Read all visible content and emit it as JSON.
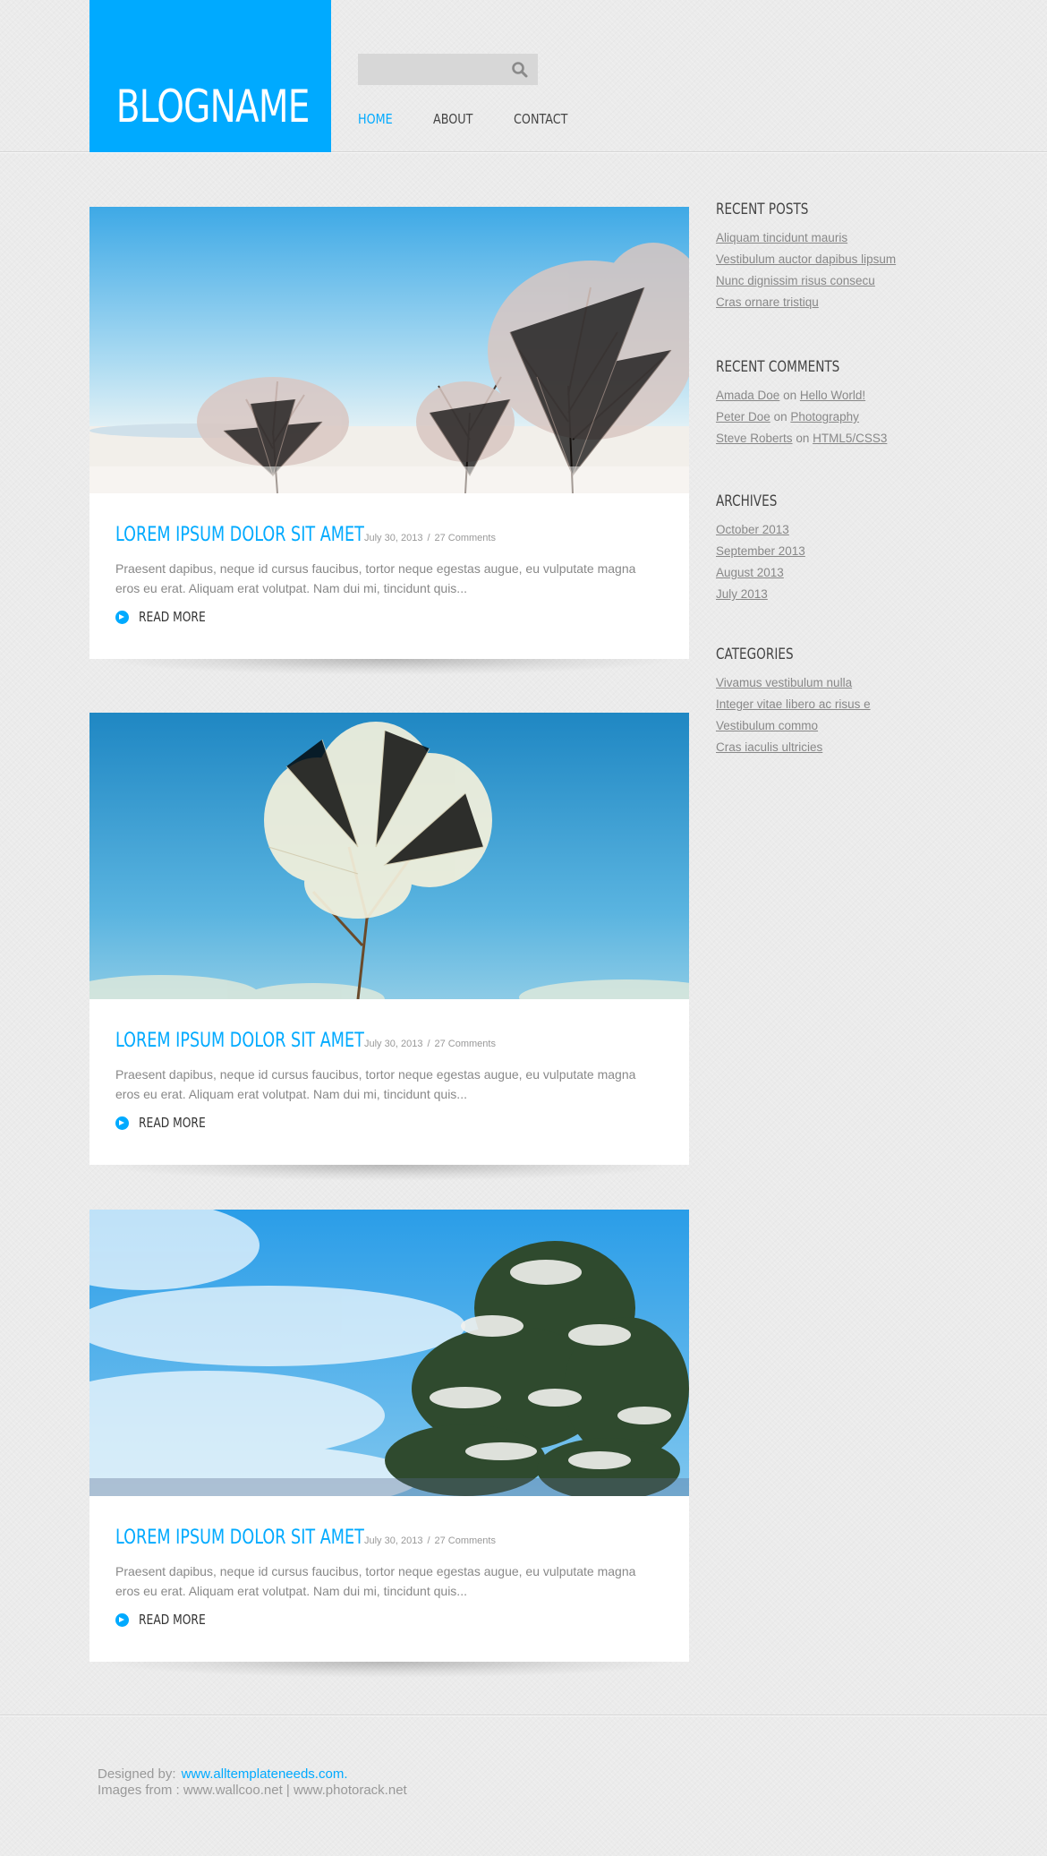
{
  "header": {
    "logo": "BLOGNAME",
    "search": {
      "placeholder": ""
    },
    "nav": [
      "HOME",
      "ABOUT",
      "CONTACT"
    ]
  },
  "posts": [
    {
      "title": "LOREM IPSUM DOLOR SIT AMET",
      "date": "July 30, 2013",
      "comments": "27 Comments",
      "excerpt": "Praesent dapibus, neque id cursus faucibus, tortor neque egestas augue, eu vulputate magna eros eu erat. Aliquam erat volutpat. Nam dui mi, tincidunt quis...",
      "read_more": "READ MORE"
    },
    {
      "title": "LOREM IPSUM DOLOR SIT AMET",
      "date": "July 30, 2013",
      "comments": "27 Comments",
      "excerpt": "Praesent dapibus, neque id cursus faucibus, tortor neque egestas augue, eu vulputate magna eros eu erat. Aliquam erat volutpat. Nam dui mi, tincidunt quis...",
      "read_more": "READ MORE"
    },
    {
      "title": "LOREM IPSUM DOLOR SIT AMET",
      "date": "July 30, 2013",
      "comments": "27 Comments",
      "excerpt": "Praesent dapibus, neque id cursus faucibus, tortor neque egestas augue, eu vulputate magna eros eu erat. Aliquam erat volutpat. Nam dui mi, tincidunt quis...",
      "read_more": "READ MORE"
    }
  ],
  "meta_separator": "/",
  "sidebar": {
    "recent_posts": {
      "title": "RECENT POSTS",
      "items": [
        "Aliquam tincidunt mauris",
        "Vestibulum auctor dapibus  lipsum",
        "Nunc dignissim risus consecu",
        "Cras ornare tristiqu"
      ]
    },
    "recent_comments": {
      "title": "RECENT COMMENTS",
      "connector": "on",
      "items": [
        {
          "author": "Amada Doe",
          "post": "Hello World!"
        },
        {
          "author": "Peter Doe",
          "post": "Photography"
        },
        {
          "author": "Steve Roberts",
          "post": "HTML5/CSS3"
        }
      ]
    },
    "archives": {
      "title": "ARCHIVES",
      "items": [
        "October 2013",
        "September 2013",
        "August 2013",
        "July 2013"
      ]
    },
    "categories": {
      "title": "CATEGORIES",
      "items": [
        "Vivamus vestibulum nulla",
        "Integer vitae libero ac risus e",
        "Vestibulum commo",
        "Cras iaculis ultricies"
      ]
    }
  },
  "footer": {
    "designed_by_label": "Designed by:",
    "designed_by_link": "www.alltemplateneeds.com.",
    "images_from": "Images from : www.wallcoo.net | www.photorack.net"
  },
  "colors": {
    "accent": "#00aaff",
    "background": "#ebebeb"
  }
}
